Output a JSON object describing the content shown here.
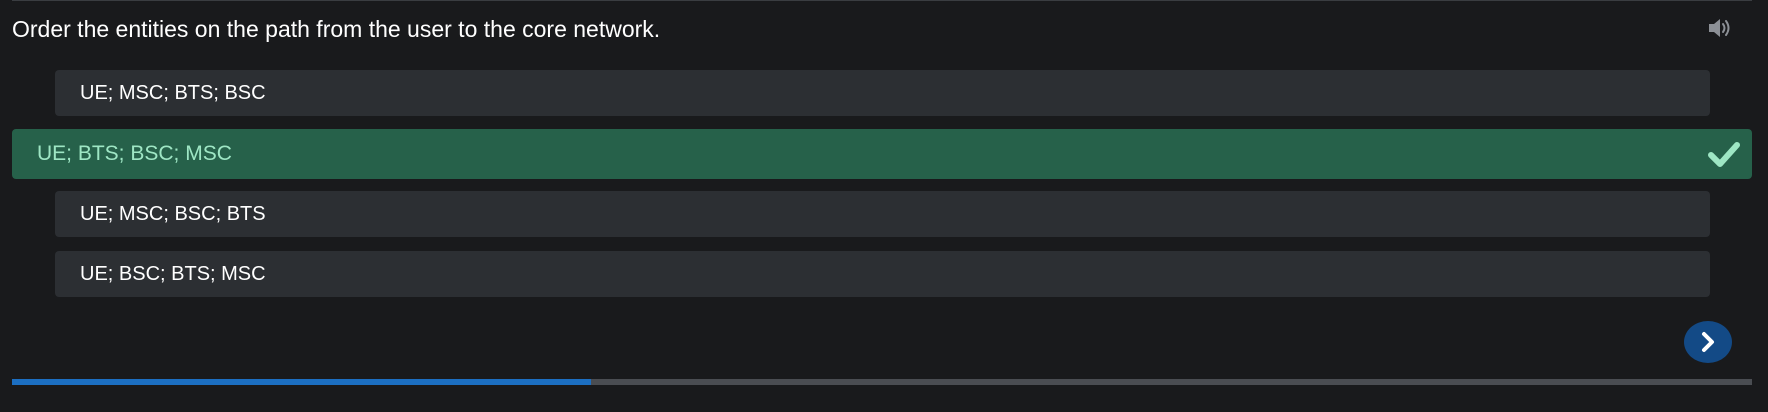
{
  "question": {
    "text": "Order the entities on the path from the user to the core network."
  },
  "options": [
    {
      "label": "UE; MSC; BTS; BSC",
      "state": "default"
    },
    {
      "label": "UE; BTS; BSC; MSC",
      "state": "correct"
    },
    {
      "label": "UE; MSC; BSC; BTS",
      "state": "default"
    },
    {
      "label": "UE; BSC; BTS; MSC",
      "state": "default"
    }
  ],
  "icons": {
    "audio": "speaker-icon",
    "correct": "checkmark-icon",
    "next": "chevron-right-icon"
  },
  "progress": {
    "fraction": 0.333
  },
  "colors": {
    "background": "#191a1c",
    "option_bg": "#2c2f33",
    "correct_bg": "#26614a",
    "correct_text": "#9ee6c4",
    "accent": "#1c6fc2",
    "next_button": "#134a86"
  }
}
